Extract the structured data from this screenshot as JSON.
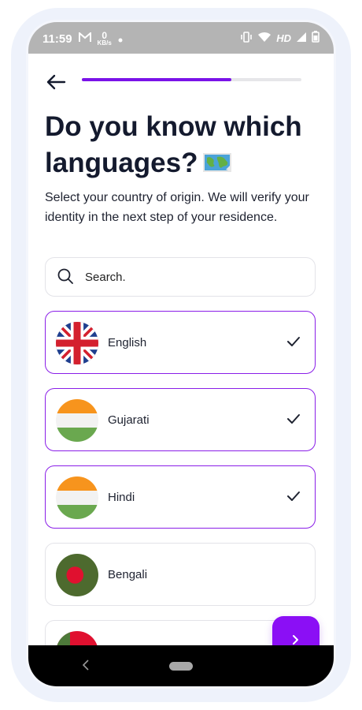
{
  "status_bar": {
    "time": "11:59",
    "speed_value": "0",
    "speed_unit": "KB/s",
    "network_label": "HD"
  },
  "header": {
    "back_icon": "arrow-left-icon",
    "progress_fraction": 0.68
  },
  "page": {
    "title_line1": "Do you know which",
    "title_line2": "languages?",
    "title_emoji": "world-map-icon",
    "subtitle": "Select your country of origin. We will verify your identity in the next step of your residence."
  },
  "search": {
    "placeholder": "Search.",
    "icon": "search-icon"
  },
  "languages": [
    {
      "label": "English",
      "flag": "uk-flag-icon",
      "selected": true
    },
    {
      "label": "Gujarati",
      "flag": "india-flag-icon",
      "selected": true
    },
    {
      "label": "Hindi",
      "flag": "india-flag-icon",
      "selected": true
    },
    {
      "label": "Bengali",
      "flag": "bangladesh-flag-icon",
      "selected": false
    },
    {
      "label": "",
      "flag": "partial-flag-icon",
      "selected": false
    }
  ],
  "fab": {
    "icon": "chevron-right-icon"
  },
  "colors": {
    "accent": "#8b0ff5",
    "progress": "#7a12e8",
    "border_selected": "#8a1ee8",
    "title": "#141a2e"
  }
}
